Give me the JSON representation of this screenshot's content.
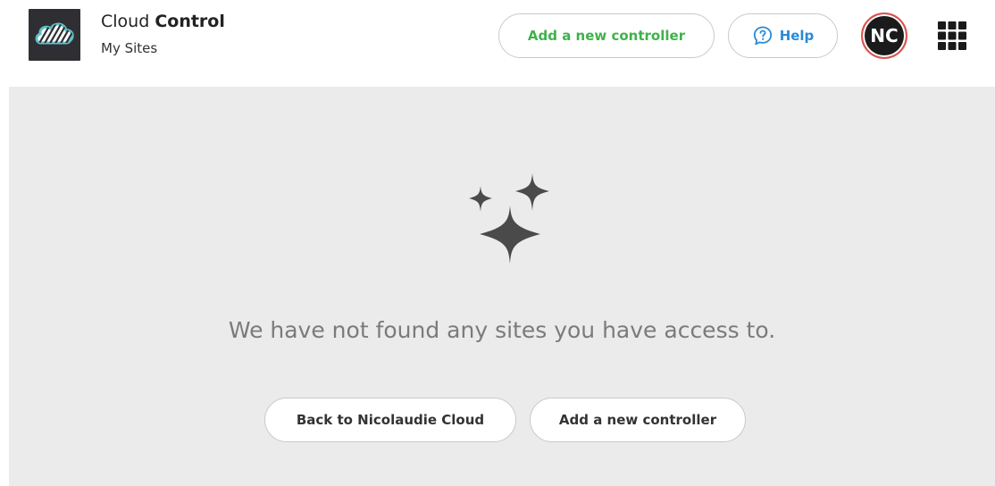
{
  "header": {
    "app_title_regular": "Cloud",
    "app_title_bold": "Control",
    "subtitle": "My Sites",
    "add_controller_label": "Add a new controller",
    "help_label": "Help",
    "avatar_initials": "NC",
    "logo_icon": "striped-cloud-icon",
    "help_icon": "question-bubble-icon",
    "apps_icon": "apps-grid-icon"
  },
  "empty_state": {
    "icon": "sparkles-icon",
    "message": "We have not found any sites you have access to.",
    "back_label": "Back to Nicolaudie Cloud",
    "add_controller_label": "Add a new controller"
  },
  "colors": {
    "accent_green": "#3fb24a",
    "help_blue": "#2a8ad6",
    "avatar_ring": "#e0534f",
    "panel_bg": "#ebebeb"
  }
}
